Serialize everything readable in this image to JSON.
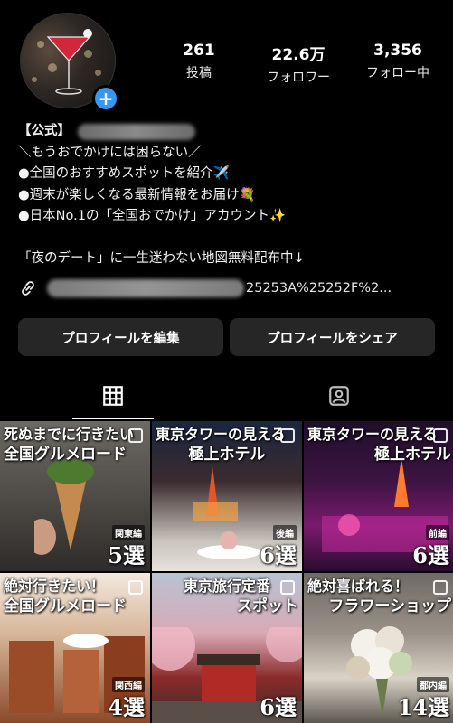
{
  "profile": {
    "stats": [
      {
        "num": "261",
        "label": "投稿"
      },
      {
        "num": "22.6万",
        "label": "フォロワー"
      },
      {
        "num": "3,356",
        "label": "フォロー中"
      }
    ],
    "name_prefix": "【公式】",
    "bio_lines": [
      "＼もうおでかけには困らない／",
      "●全国のおすすめスポットを紹介✈️",
      "●週末が楽しくなる最新情報をお届け💐",
      "●日本No.1の「全国おでかけ」アカウント✨"
    ],
    "bio_extra": "「夜のデート」に一生迷わない地図無料配布中↓",
    "link_suffix": "25253A%25252F%2..."
  },
  "buttons": {
    "edit": "プロフィールを編集",
    "share": "プロフィールをシェア"
  },
  "posts": [
    {
      "title1": "死ぬまでに行きたい",
      "title2": "全国グルメロード",
      "tag": "関東編",
      "count": "5選"
    },
    {
      "title1": "東京タワーの見える",
      "title2": "極上ホテル",
      "tag": "後編",
      "count": "6選"
    },
    {
      "title1": "東京タワーの見える",
      "title2": "極上ホテル",
      "tag": "前編",
      "count": "6選"
    },
    {
      "title1": "絶対行きたい！",
      "title2": "全国グルメロード",
      "tag": "関西編",
      "count": "4選"
    },
    {
      "title1": "東京旅行定番",
      "title2": "スポット",
      "tag": "",
      "count": "6選"
    },
    {
      "title1": "絶対喜ばれる！",
      "title2": "フラワーショップ",
      "tag": "都内編",
      "count": "14選"
    }
  ],
  "colors": {
    "background": "#000000",
    "button": "#262626",
    "accent": "#3797f0"
  }
}
